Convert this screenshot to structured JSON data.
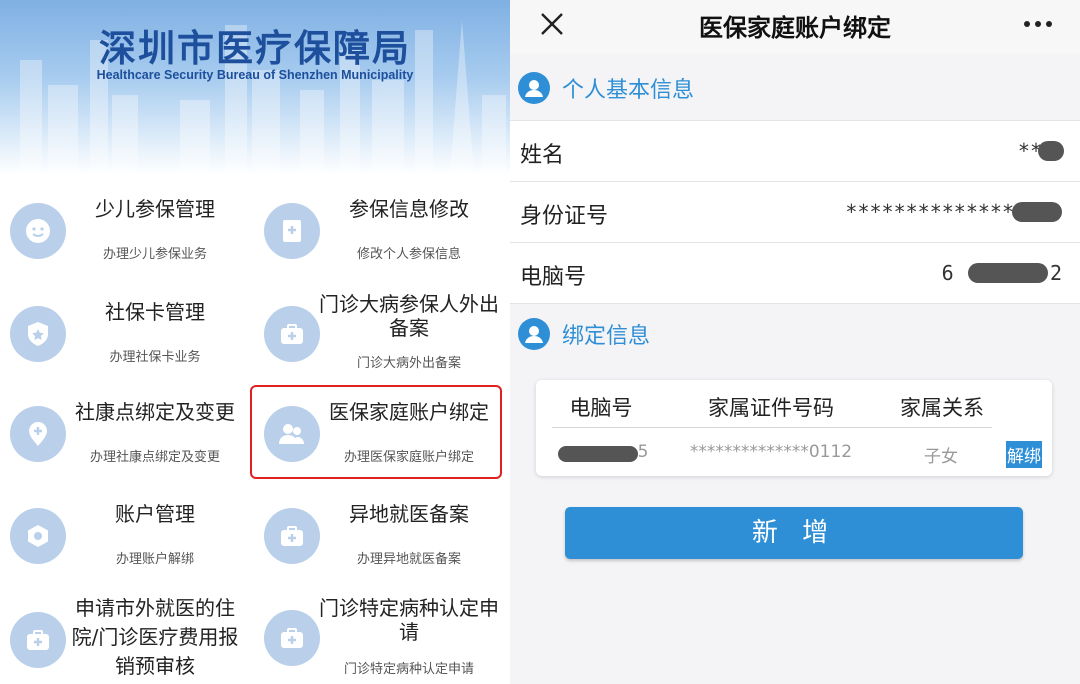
{
  "left": {
    "banner_title": "深圳市医疗保障局",
    "banner_subtitle": "Healthcare Security Bureau of Shenzhen Municipality",
    "services": [
      {
        "title": "少儿参保管理",
        "desc": "办理少儿参保业务",
        "icon": "child-face-icon"
      },
      {
        "title": "参保信息修改",
        "desc": "修改个人参保信息",
        "icon": "medical-doc-icon"
      },
      {
        "title": "社保卡管理",
        "desc": "办理社保卡业务",
        "icon": "shield-star-icon"
      },
      {
        "title": "门诊大病参保人外出备案",
        "desc": "门诊大病外出备案",
        "icon": "medkit-icon"
      },
      {
        "title": "社康点绑定及变更",
        "desc": "办理社康点绑定及变更",
        "icon": "location-plus-icon"
      },
      {
        "title": "医保家庭账户绑定",
        "desc": "办理医保家庭账户绑定",
        "icon": "family-icon"
      },
      {
        "title": "账户管理",
        "desc": "办理账户解绑",
        "icon": "hexagon-nut-icon"
      },
      {
        "title": "异地就医备案",
        "desc": "办理异地就医备案",
        "icon": "medkit-icon"
      },
      {
        "title": "申请市外就医的住院/门诊医疗费用报销预审核",
        "desc": "",
        "icon": "medkit-icon"
      },
      {
        "title": "门诊特定病种认定申请",
        "desc": "门诊特定病种认定申请",
        "icon": "medkit-icon"
      }
    ]
  },
  "right": {
    "nav_title": "医保家庭账户绑定",
    "personal_section": "个人基本信息",
    "fields": [
      {
        "label": "姓名",
        "value": "**"
      },
      {
        "label": "身份证号",
        "value": "**************"
      },
      {
        "label": "电脑号",
        "value": "6        2"
      }
    ],
    "binding_section": "绑定信息",
    "table": {
      "headers": [
        "电脑号",
        "家属证件号码",
        "家属关系"
      ],
      "row": {
        "computer_no": "5",
        "id_no": "**************0112",
        "relation": "子女",
        "action": "解绑"
      }
    },
    "add_button": "新 增"
  },
  "colors": {
    "accent": "#2f8fd6",
    "highlight": "#e02020",
    "icon_bg": "#b9cfea",
    "banner_title": "#1d4f9c"
  }
}
